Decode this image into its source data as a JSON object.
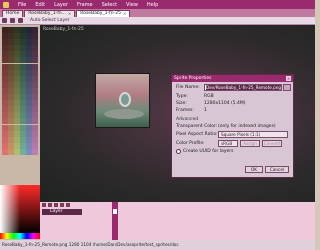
{
  "menu": [
    "File",
    "Edit",
    "Layer",
    "Frame",
    "Select",
    "View",
    "Help"
  ],
  "tabs": [
    {
      "label": "Home",
      "active": false
    },
    {
      "label": "RoseBaby_1-fn...",
      "active": false
    },
    {
      "label": "RoseBaby_1-fn-25",
      "active": true
    }
  ],
  "toolbar": {
    "label": "Auto Select Layer"
  },
  "canvas": {
    "label": "RoseBaby_1-fn-25"
  },
  "dialog": {
    "title": "Sprite Properties",
    "file_name_label": "File Name:",
    "file_name_value": "Dev/RoseBaby_1-fn-25_Remote.png",
    "type_label": "Type:",
    "type_value": "RGB",
    "size_label": "Size:",
    "size_value": "1280x1104 (5.4M)",
    "frames_label": "Frames:",
    "frames_value": "1",
    "advanced_label": "Advanced",
    "transparent_label": "Transparent Color:",
    "transparent_value": "(only for indexed images)",
    "pixel_ratio_label": "Pixel Aspect Ratio:",
    "pixel_ratio_value": "Square Pixels (1:1)",
    "color_profile_label": "Color Profile:",
    "color_profile_value": "sRGB",
    "assign_label": "Assign",
    "convert_label": "Convert",
    "uuid_label": "Create UUID for layers",
    "ok_label": "OK",
    "cancel_label": "Cancel"
  },
  "layers": {
    "name": "Layer"
  },
  "status": {
    "text": "RoseBaby_1-fn-25_Remote.png   1280  1104   /home/Dan/Dev/aseprite/test_sprites/doc"
  },
  "colors": {
    "accent": "#9a2a6e",
    "menu_bg": "#9a2a6e",
    "panel_bg": "#f0c8dc"
  }
}
